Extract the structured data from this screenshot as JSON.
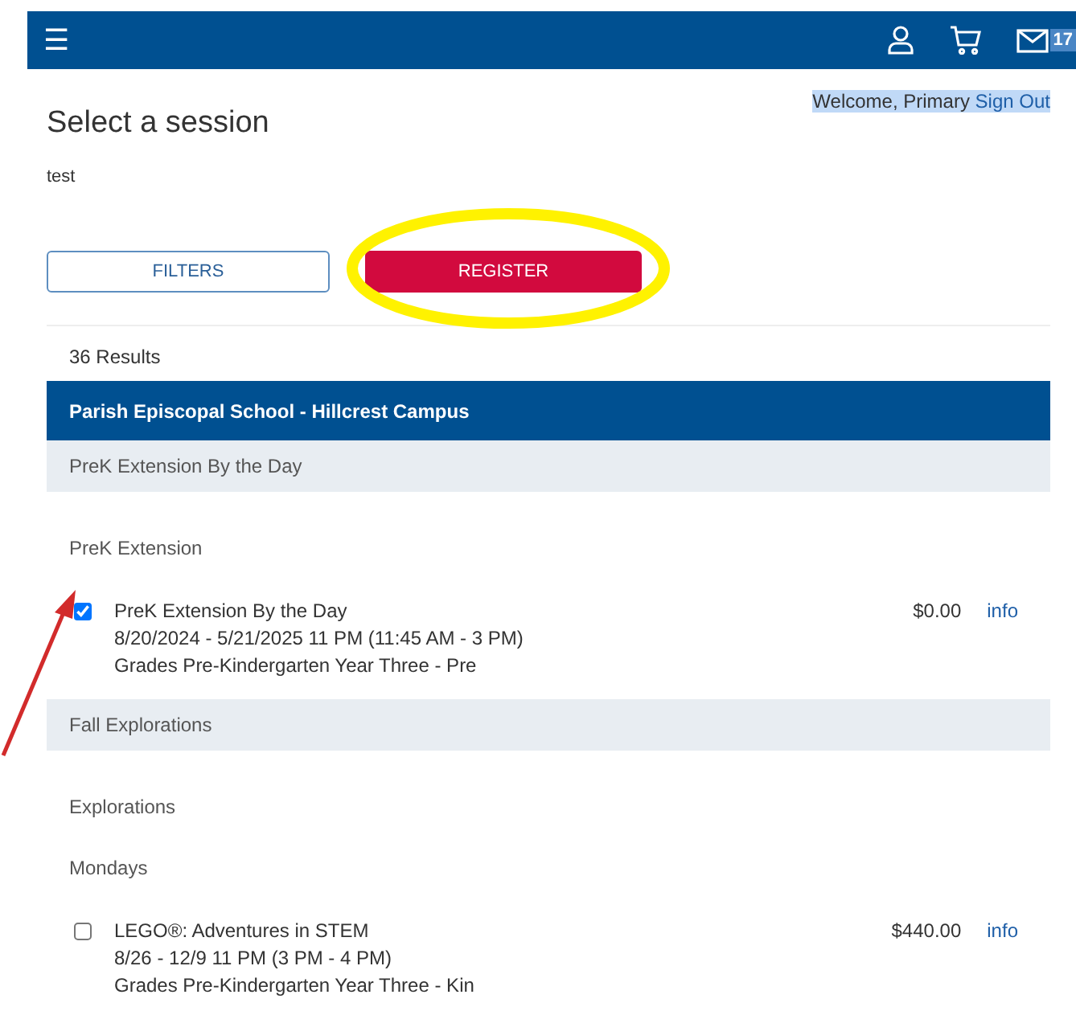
{
  "top_bar": {
    "menu_icon": "☰",
    "message_count": "17"
  },
  "welcome": {
    "text": "Welcome, Primary",
    "link": "Sign Out"
  },
  "title": "Select a session",
  "subtitle": "test",
  "buttons": {
    "filters": "FILTERS",
    "register": "REGISTER"
  },
  "results_count": "36 Results",
  "results": [
    {
      "kind": "location",
      "text": "Parish Episcopal School - Hillcrest Campus"
    },
    {
      "kind": "program",
      "text": "PreK Extension By the Day"
    },
    {
      "kind": "label",
      "text": "PreK Extension"
    },
    {
      "kind": "session",
      "checked": true,
      "title": "PreK Extension By the Day",
      "dates": "8/20/2024 - 5/21/2025 11 PM (11:45 AM - 3 PM)",
      "grades": "Grades Pre-Kindergarten Year Three - Pre",
      "price": "$0.00",
      "link": "info"
    },
    {
      "kind": "program",
      "text": "Fall Explorations"
    },
    {
      "kind": "label",
      "text": "Explorations"
    },
    {
      "kind": "label",
      "text": "Mondays"
    },
    {
      "kind": "session",
      "checked": false,
      "title": "LEGO®: Adventures in STEM",
      "dates": "8/26 - 12/9 11 PM (3 PM - 4 PM)",
      "grades": "Grades Pre-Kindergarten Year Three - Kin",
      "price": "$440.00",
      "link": "info"
    }
  ]
}
